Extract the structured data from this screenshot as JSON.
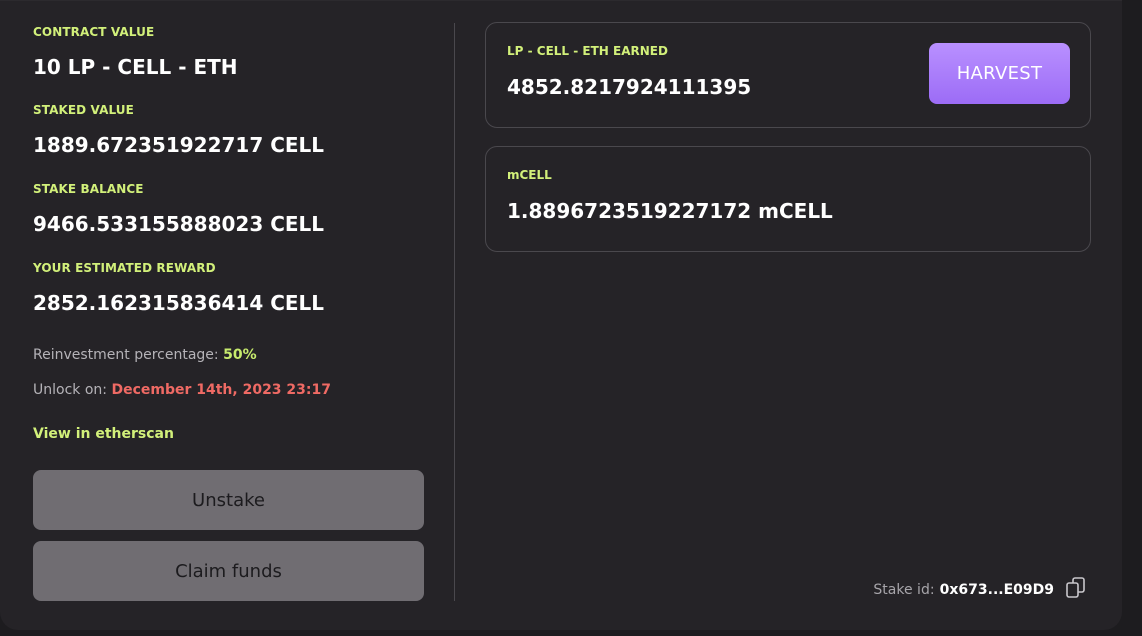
{
  "left": {
    "contract_value_label": "CONTRACT VALUE",
    "contract_value": "10 LP - CELL - ETH",
    "staked_value_label": "STAKED VALUE",
    "staked_value": "1889.672351922717 CELL",
    "stake_balance_label": "STAKE BALANCE",
    "stake_balance": "9466.533155888023 CELL",
    "estimated_reward_label": "YOUR ESTIMATED REWARD",
    "estimated_reward": "2852.162315836414 CELL",
    "reinvestment_label": "Reinvestment percentage:",
    "reinvestment_value": "50%",
    "unlock_label": "Unlock on:",
    "unlock_value": "December 14th, 2023 23:17",
    "etherscan_link": "View in etherscan",
    "unstake_button": "Unstake",
    "claim_button": "Claim funds"
  },
  "earned_panel": {
    "label": "LP - CELL - ETH EARNED",
    "value": "4852.8217924111395",
    "harvest_button": "HARVEST"
  },
  "mcell_panel": {
    "label": "mCELL",
    "value": "1.8896723519227172 mCELL"
  },
  "footer": {
    "stake_id_label": "Stake id:",
    "stake_id_value": "0x673...E09D9",
    "copy_icon": "copy-icon"
  },
  "colors": {
    "accent_label": "#d2f07a",
    "highlight_red": "#ef6a64",
    "harvest_purple": "#a97cf8",
    "background": "#252327"
  }
}
